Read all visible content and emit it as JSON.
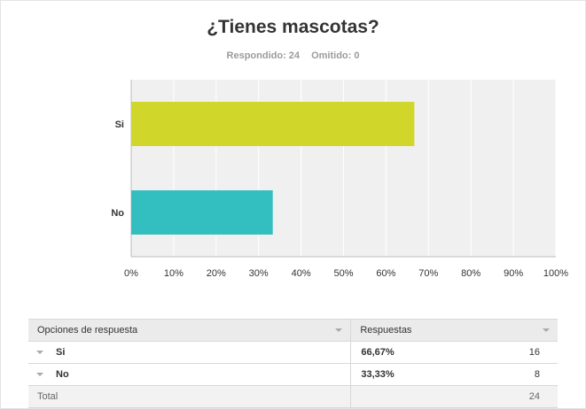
{
  "title": "¿Tienes mascotas?",
  "summary": {
    "answered_label": "Respondido: 24",
    "skipped_label": "Omitido: 0"
  },
  "colors": {
    "si": "#d1d62a",
    "no": "#33bec0",
    "plot_bg": "#f0f0f0"
  },
  "chart_data": {
    "type": "bar",
    "orientation": "horizontal",
    "categories": [
      "Si",
      "No"
    ],
    "values": [
      66.67,
      33.33
    ],
    "xlim": [
      0,
      100
    ],
    "x_ticks": [
      "0%",
      "10%",
      "20%",
      "30%",
      "40%",
      "50%",
      "60%",
      "70%",
      "80%",
      "90%",
      "100%"
    ],
    "grid": true
  },
  "table": {
    "headers": [
      "Opciones de respuesta",
      "Respuestas"
    ],
    "rows": [
      {
        "option": "Si",
        "percent": "66,67%",
        "count": "16"
      },
      {
        "option": "No",
        "percent": "33,33%",
        "count": "8"
      }
    ],
    "total_label": "Total",
    "total_count": "24"
  }
}
